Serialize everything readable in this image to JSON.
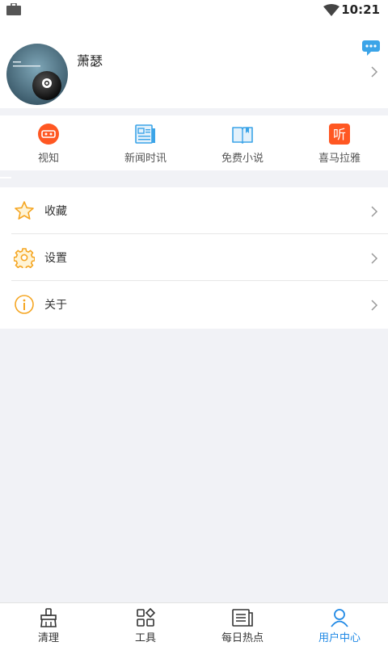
{
  "status_bar": {
    "time": "10:21"
  },
  "profile": {
    "username": "萧瑟"
  },
  "quick_links": [
    {
      "label": "视知",
      "icon": "shizhi-icon"
    },
    {
      "label": "新闻时讯",
      "icon": "news-icon"
    },
    {
      "label": "免费小说",
      "icon": "book-icon"
    },
    {
      "label": "喜马拉雅",
      "icon": "ximalaya-icon",
      "icon_text": "听"
    }
  ],
  "menu": [
    {
      "label": "收藏",
      "icon": "star-icon"
    },
    {
      "label": "设置",
      "icon": "gear-icon"
    },
    {
      "label": "关于",
      "icon": "info-icon"
    }
  ],
  "tabs": [
    {
      "label": "清理",
      "icon": "broom-icon",
      "active": false
    },
    {
      "label": "工具",
      "icon": "tools-grid-icon",
      "active": false
    },
    {
      "label": "每日热点",
      "icon": "newspaper-icon",
      "active": false
    },
    {
      "label": "用户中心",
      "icon": "user-icon",
      "active": true
    }
  ],
  "colors": {
    "accent": "#1e88e5",
    "orange": "#f5a623",
    "red": "#ff5722",
    "page_bg": "#f1f2f6"
  }
}
